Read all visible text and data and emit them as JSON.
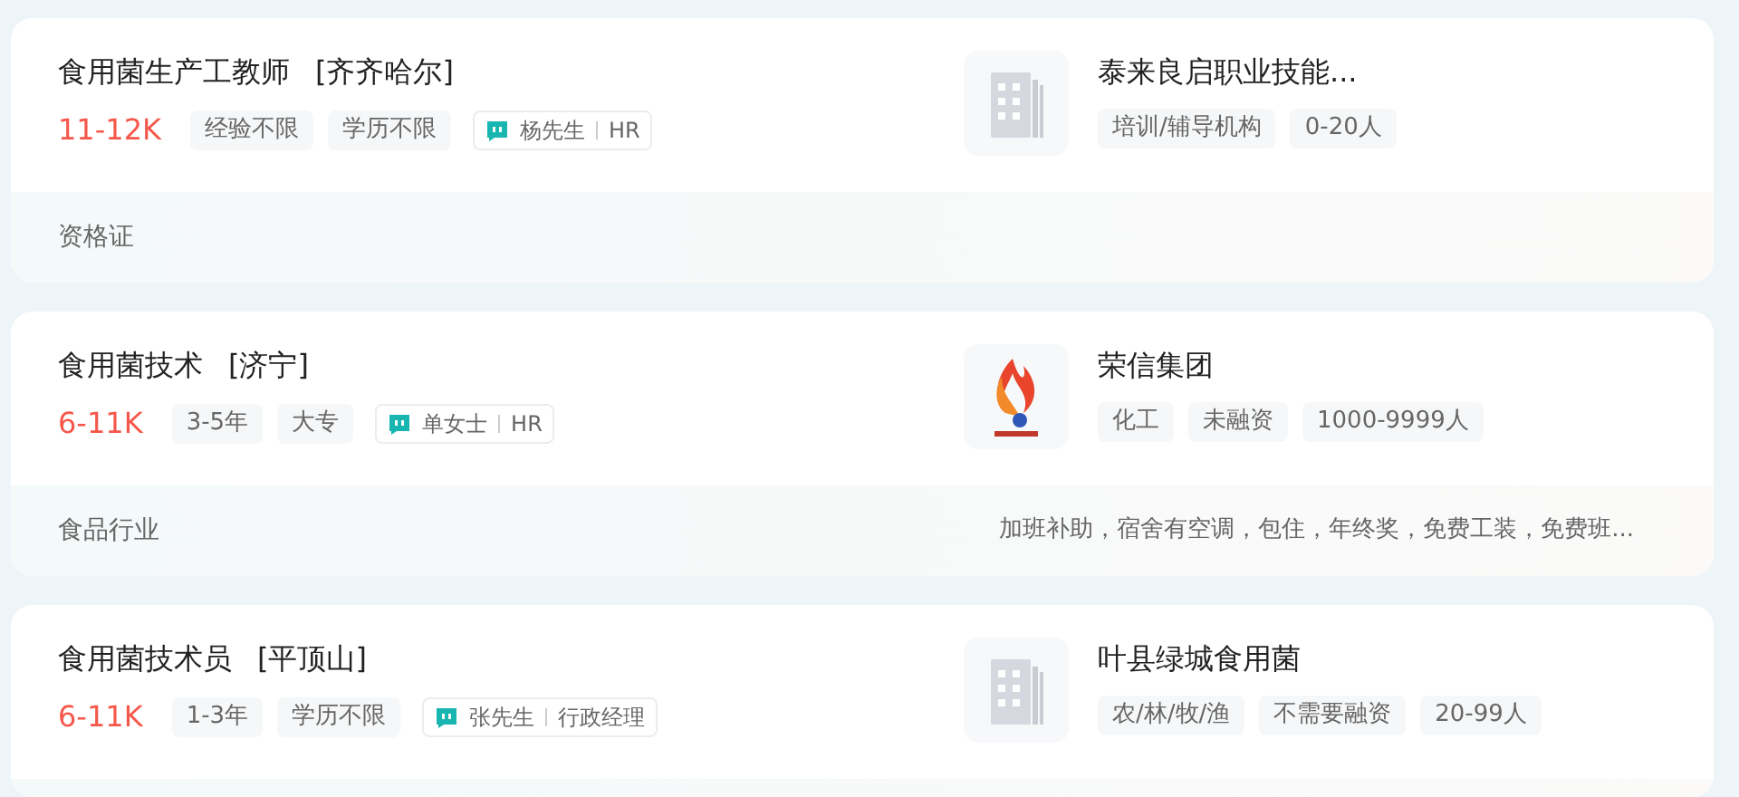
{
  "jobs": [
    {
      "title": "食用菌生产工教师",
      "city": "[齐齐哈尔]",
      "salary": "11-12K",
      "tags": [
        "经验不限",
        "学历不限"
      ],
      "contact": {
        "name": "杨先生",
        "role": "HR"
      },
      "company": {
        "name": "泰来良启职业技能...",
        "kind": "building",
        "tags": [
          "培训/辅导机构",
          "0-20人"
        ]
      },
      "skills": "资格证"
    },
    {
      "title": "食用菌技术",
      "city": "[济宁]",
      "salary": "6-11K",
      "tags": [
        "3-5年",
        "大专"
      ],
      "contact": {
        "name": "单女士",
        "role": "HR"
      },
      "company": {
        "name": "荣信集团",
        "kind": "brand",
        "tags": [
          "化工",
          "未融资",
          "1000-9999人"
        ]
      },
      "skills": "食品行业",
      "benefits": "加班补助，宿舍有空调，包住，年终奖，免费工装，免费班..."
    },
    {
      "title": "食用菌技术员",
      "city": "[平顶山]",
      "salary": "6-11K",
      "tags": [
        "1-3年",
        "学历不限"
      ],
      "contact": {
        "name": "张先生",
        "role": "行政经理"
      },
      "company": {
        "name": "叶县绿城食用菌",
        "kind": "building",
        "tags": [
          "农/林/牧/渔",
          "不需要融资",
          "20-99人"
        ]
      }
    }
  ]
}
